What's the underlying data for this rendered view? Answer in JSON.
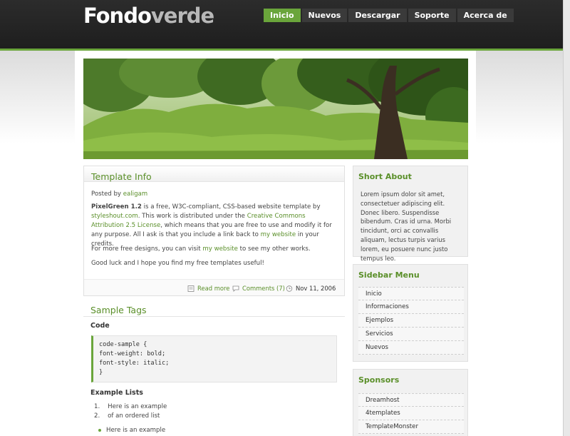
{
  "site": {
    "logo_part1": "Fondo",
    "logo_part2": "verde"
  },
  "nav": {
    "items": [
      {
        "label": "Inicio",
        "active": true
      },
      {
        "label": "Nuevos",
        "active": false
      },
      {
        "label": "Descargar",
        "active": false
      },
      {
        "label": "Soporte",
        "active": false
      },
      {
        "label": "Acerca de",
        "active": false
      }
    ]
  },
  "post": {
    "title": "Template Info",
    "posted_by_label": "Posted by",
    "author": "ealigam",
    "p1_bold": "PixelGreen 1.2",
    "p1_a": " is a free, W3C-compliant, CSS-based website template by ",
    "p1_link1": "styleshout.com",
    "p1_b": ". This work is distributed under the ",
    "p1_link2": "Creative Commons Attribution 2.5 License",
    "p1_c": ", which means that you are free to use and modify it for any purpose. All I ask is that you include a link back to ",
    "p1_link3": "my website",
    "p1_d": " in your credits.",
    "p2_a": "For more free designs, you can visit ",
    "p2_link": "my website",
    "p2_b": " to see my other works.",
    "p3": "Good luck and I hope you find my free templates useful!",
    "read_more": "Read more",
    "comments": "Comments (7)",
    "date": "Nov 11, 2006"
  },
  "tags": {
    "title": "Sample Tags",
    "code_heading": "Code",
    "code_lines": [
      "code-sample {",
      "font-weight: bold;",
      "font-style: italic;",
      "}"
    ],
    "lists_heading": "Example Lists",
    "ordered": [
      "Here is an example",
      "of an ordered list"
    ],
    "unordered": [
      "Here is an example"
    ]
  },
  "sidebar": {
    "about_title": "Short About",
    "about_text": "Lorem ipsum dolor sit amet, consectetuer adipiscing elit. Donec libero. Suspendisse bibendum. Cras id urna. Morbi tincidunt, orci ac convallis aliquam, lectus turpis varius lorem, eu posuere nunc justo tempus leo.",
    "menu_title": "Sidebar Menu",
    "menu_items": [
      "Inicio",
      "Informaciones",
      "Ejemplos",
      "Servicios",
      "Nuevos"
    ],
    "sponsors_title": "Sponsors",
    "sponsors": [
      "Dreamhost",
      "4templates",
      "TemplateMonster"
    ]
  },
  "colors": {
    "accent": "#6aa53b",
    "link": "#5a8f29",
    "header_bg": "#262626"
  }
}
